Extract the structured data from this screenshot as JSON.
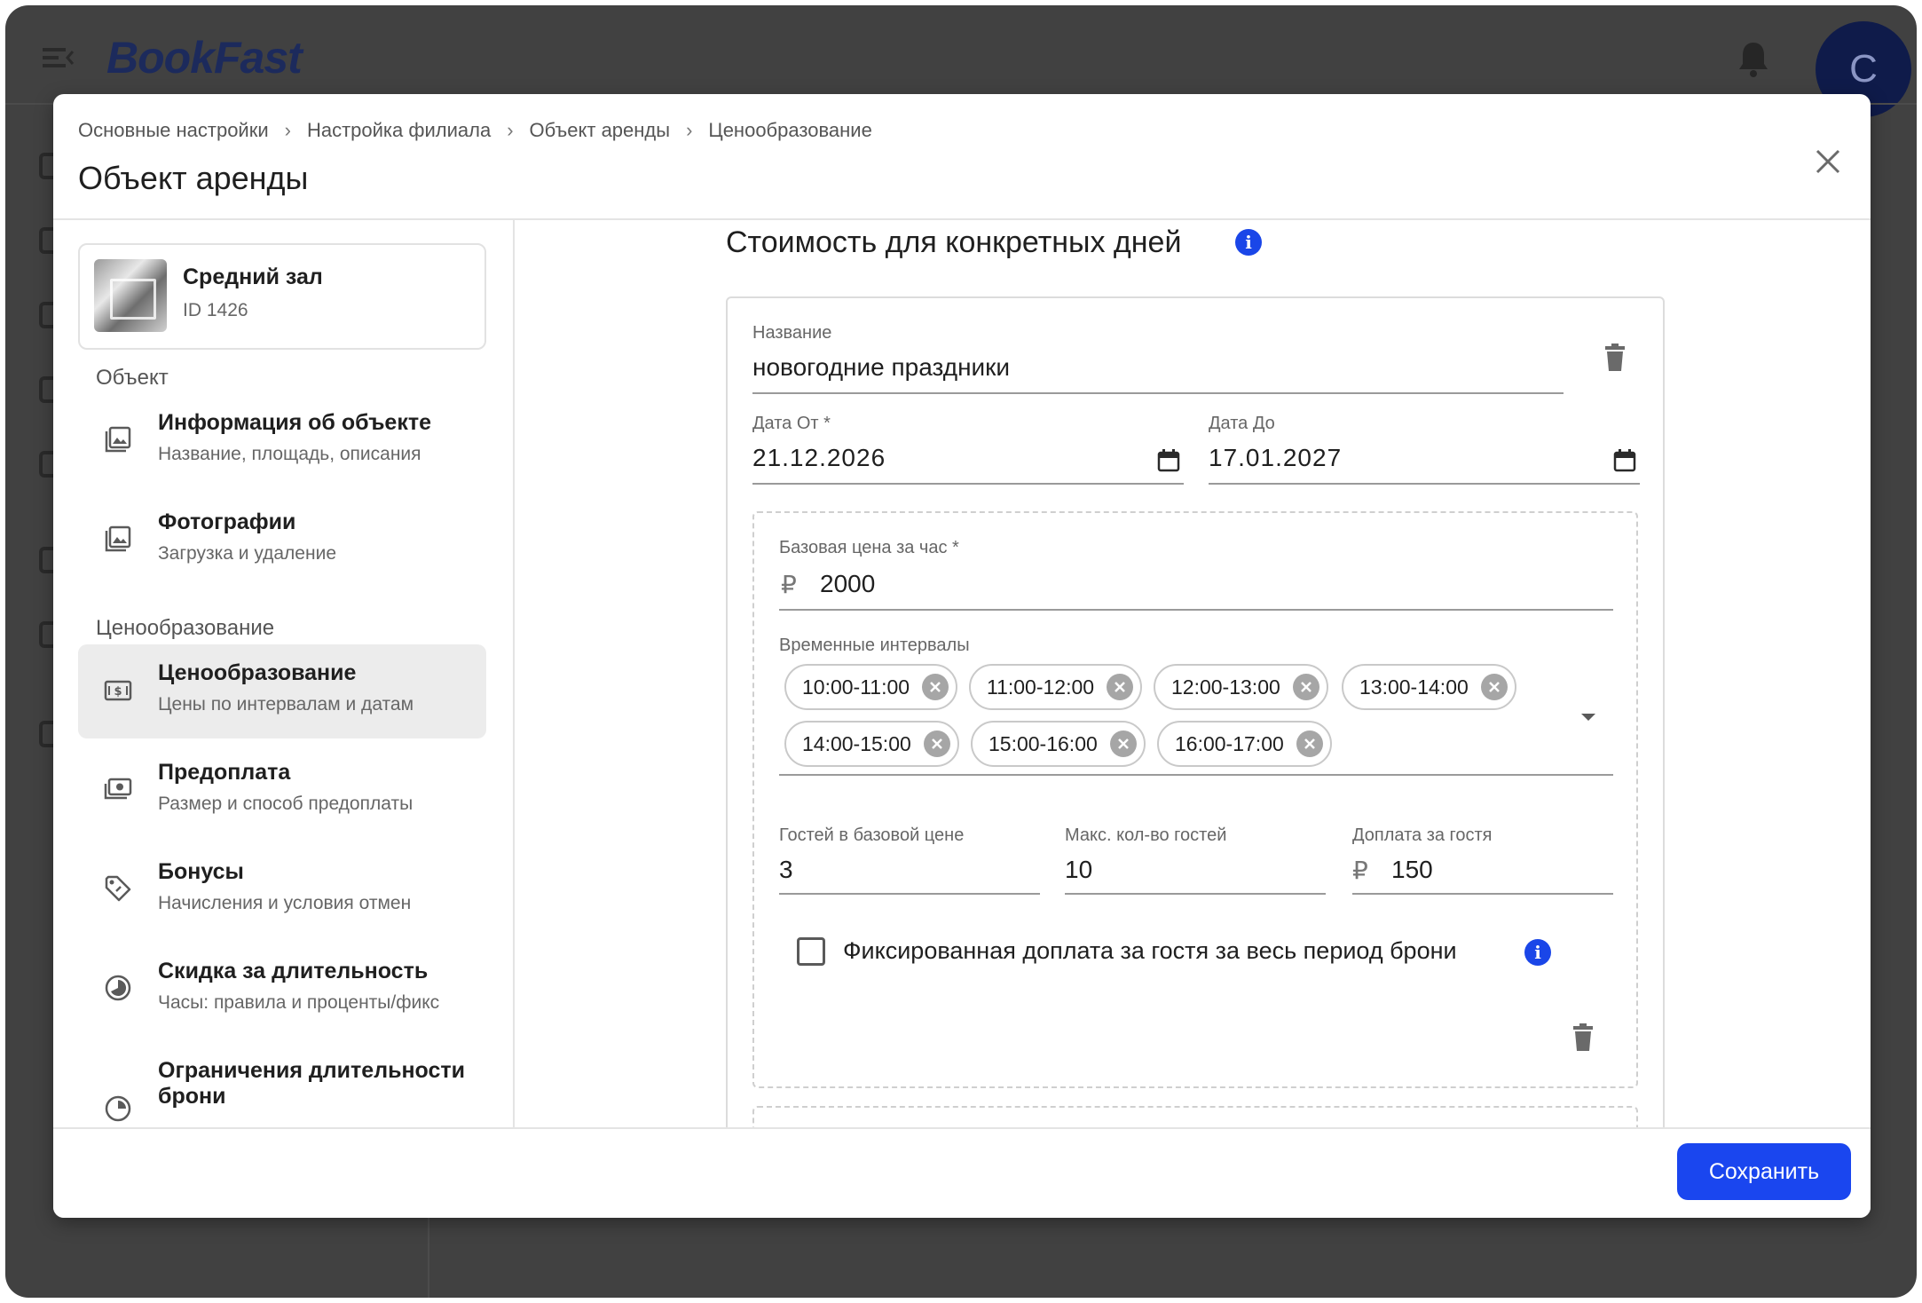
{
  "app": {
    "logo": "BookFast",
    "avatar_letter": "С"
  },
  "modal": {
    "breadcrumb": [
      "Основные настройки",
      "Настройка филиала",
      "Объект аренды",
      "Ценообразование"
    ],
    "title": "Объект аренды"
  },
  "sidebar": {
    "object": {
      "name": "Средний зал",
      "id": "ID 1426"
    },
    "section_object": "Объект",
    "section_pricing": "Ценообразование",
    "items": [
      {
        "title": "Информация об объекте",
        "subtitle": "Название, площадь, описания",
        "icon": "image-icon"
      },
      {
        "title": "Фотографии",
        "subtitle": "Загрузка и удаление",
        "icon": "photos-icon"
      },
      {
        "title": "Ценообразование",
        "subtitle": "Цены по интервалам и датам",
        "icon": "pricing-icon"
      },
      {
        "title": "Предоплата",
        "subtitle": "Размер и способ предоплаты",
        "icon": "prepayment-icon"
      },
      {
        "title": "Бонусы",
        "subtitle": "Начисления и условия отмен",
        "icon": "tag-icon"
      },
      {
        "title": "Скидка за длительность",
        "subtitle": "Часы: правила и проценты/фикс",
        "icon": "discount-icon"
      },
      {
        "title": "Ограничения длительности брони",
        "subtitle": "",
        "icon": "limit-icon"
      }
    ]
  },
  "main": {
    "section_title": "Стоимость для конкретных дней",
    "name_label": "Название",
    "name_value": "новогодние праздники",
    "date_from_label": "Дата От *",
    "date_from_value": "21.12.2026",
    "date_to_label": "Дата До",
    "date_to_value": "17.01.2027",
    "base_price_label": "Базовая цена за час *",
    "currency": "₽",
    "base_price_value": "2000",
    "intervals_label": "Временные интервалы",
    "intervals": [
      "10:00-11:00",
      "11:00-12:00",
      "12:00-13:00",
      "13:00-14:00",
      "14:00-15:00",
      "15:00-16:00",
      "16:00-17:00"
    ],
    "guests_base_label": "Гостей в базовой цене",
    "guests_base_value": "3",
    "max_guests_label": "Макс. кол-во гостей",
    "max_guests_value": "10",
    "extra_guest_label": "Доплата за гостя",
    "extra_guest_value": "150",
    "fixed_fee_label": "Фиксированная доплата за гостя за весь период брони",
    "fixed_fee_checked": false
  },
  "footer": {
    "save_label": "Сохранить"
  },
  "colors": {
    "accent": "#1a46ef",
    "info": "#1a46e8"
  }
}
